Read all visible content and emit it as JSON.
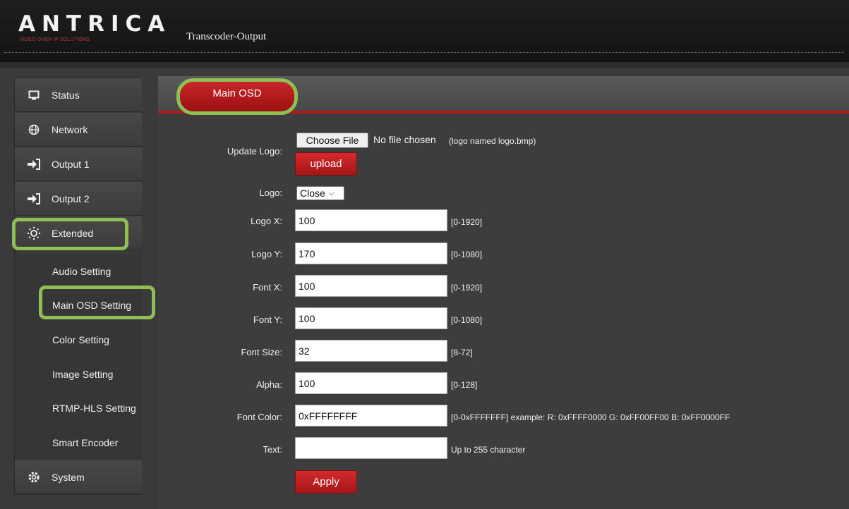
{
  "header": {
    "logo": "ANTRICA",
    "logo_tagline": "VIDEO OVER IP SOLUTIONS",
    "page_title": "Transcoder-Output"
  },
  "sidebar": {
    "items": [
      {
        "label": "Status",
        "icon": "monitor-icon"
      },
      {
        "label": "Network",
        "icon": "globe-icon"
      },
      {
        "label": "Output 1",
        "icon": "sign-in-icon"
      },
      {
        "label": "Output 2",
        "icon": "sign-in-icon"
      },
      {
        "label": "Extended",
        "icon": "sun-icon"
      }
    ],
    "subitems": [
      {
        "label": "Audio Setting"
      },
      {
        "label": "Main OSD Setting"
      },
      {
        "label": "Color Setting"
      },
      {
        "label": "Image Setting"
      },
      {
        "label": "RTMP-HLS Setting"
      },
      {
        "label": "Smart Encoder"
      }
    ],
    "system": {
      "label": "System",
      "icon": "gear-icon"
    }
  },
  "main": {
    "tab_label": "Main OSD",
    "update_logo": {
      "label": "Update Logo:",
      "choose_file": "Choose File",
      "file_status": "No file chosen",
      "hint": "(logo named logo.bmp)",
      "upload": "upload"
    },
    "logo": {
      "label": "Logo:",
      "value": "Close"
    },
    "fields": [
      {
        "label": "Logo X:",
        "value": "100",
        "range": "[0-1920]"
      },
      {
        "label": "Logo Y:",
        "value": "170",
        "range": "[0-1080]"
      },
      {
        "label": "Font X:",
        "value": "100",
        "range": "[0-1920]"
      },
      {
        "label": "Font Y:",
        "value": "100",
        "range": "[0-1080]"
      },
      {
        "label": "Font Size:",
        "value": "32",
        "range": "[8-72]"
      },
      {
        "label": "Alpha:",
        "value": "100",
        "range": "[0-128]"
      },
      {
        "label": "Font Color:",
        "value": "0xFFFFFFFF",
        "range": "[0-0xFFFFFFF] example:  R: 0xFFFF0000 G: 0xFF00FF00 B: 0xFF0000FF"
      },
      {
        "label": "Text:",
        "value": "",
        "range": "Up to 255 character"
      }
    ],
    "apply": "Apply"
  },
  "colors": {
    "accent_red": "#b21a1a",
    "highlight_green": "#8fbe55",
    "background": "#3a3a3a"
  }
}
